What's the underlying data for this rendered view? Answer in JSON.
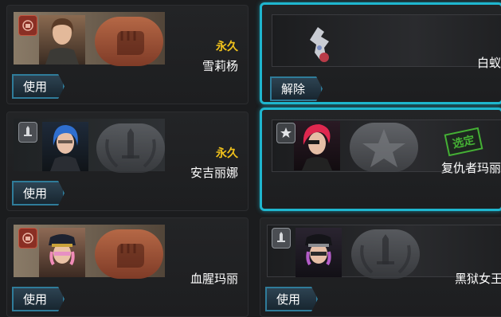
{
  "cards": [
    {
      "name": "雪莉杨",
      "duration": "永久",
      "button": "使用",
      "emblem": "fist-emblem-icon",
      "portrait": "character-portrait"
    },
    {
      "name": "白蚁",
      "duration": "",
      "button": "解除",
      "emblem": "",
      "portrait": "pet-portrait",
      "selected": true
    },
    {
      "name": "安吉丽娜",
      "duration": "永久",
      "button": "使用",
      "emblem": "sword-emblem-icon",
      "portrait": "character-portrait"
    },
    {
      "name": "复仇者玛丽",
      "duration": "",
      "button": "",
      "stamp": "选定",
      "emblem": "star-emblem-icon",
      "portrait": "character-portrait",
      "selected": true
    },
    {
      "name": "血腥玛丽",
      "duration": "",
      "button": "使用",
      "emblem": "fist-emblem-icon",
      "portrait": "character-portrait"
    },
    {
      "name": "黑狱女王",
      "duration": "",
      "button": "使用",
      "emblem": "sword-emblem-icon",
      "portrait": "character-portrait"
    }
  ],
  "colors": {
    "selected_border": "#1fb6cf",
    "duration": "#f1c21b",
    "stamp": "#45b035"
  }
}
